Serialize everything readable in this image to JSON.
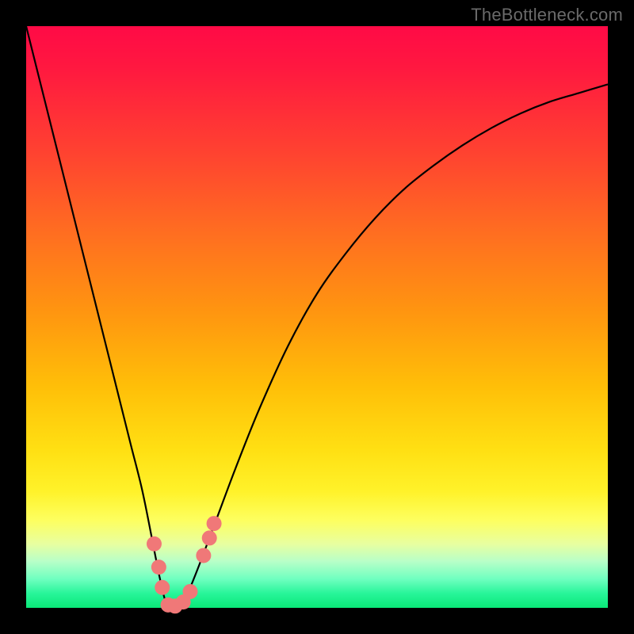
{
  "watermark": "TheBottleneck.com",
  "chart_data": {
    "type": "line",
    "title": "",
    "xlabel": "",
    "ylabel": "",
    "xlim": [
      0,
      100
    ],
    "ylim": [
      0,
      100
    ],
    "series": [
      {
        "name": "bottleneck-curve",
        "x": [
          0,
          2,
          4,
          6,
          8,
          10,
          12,
          14,
          16,
          18,
          20,
          22,
          23,
          24,
          25,
          26,
          27,
          28,
          30,
          33,
          36,
          40,
          45,
          50,
          55,
          60,
          65,
          70,
          75,
          80,
          85,
          90,
          95,
          100
        ],
        "y": [
          100,
          92,
          84,
          76,
          68,
          60,
          52,
          44,
          36,
          28,
          20,
          10,
          5,
          1,
          0,
          0,
          1,
          3,
          8,
          16,
          24,
          34,
          45,
          54,
          61,
          67,
          72,
          76,
          79.5,
          82.5,
          85,
          87,
          88.5,
          90
        ]
      }
    ],
    "markers": [
      {
        "name": "marker-left-upper",
        "x": 22.0,
        "y": 11.0
      },
      {
        "name": "marker-left-mid",
        "x": 22.8,
        "y": 7.0
      },
      {
        "name": "marker-left-low",
        "x": 23.4,
        "y": 3.5
      },
      {
        "name": "marker-bottom-1",
        "x": 24.4,
        "y": 0.5
      },
      {
        "name": "marker-bottom-2",
        "x": 25.6,
        "y": 0.3
      },
      {
        "name": "marker-bottom-3",
        "x": 27.0,
        "y": 1.0
      },
      {
        "name": "marker-bottom-4",
        "x": 28.2,
        "y": 2.8
      },
      {
        "name": "marker-right-low",
        "x": 30.5,
        "y": 9.0
      },
      {
        "name": "marker-right-mid",
        "x": 31.5,
        "y": 12.0
      },
      {
        "name": "marker-right-upper",
        "x": 32.3,
        "y": 14.5
      }
    ],
    "marker_color": "#f07878",
    "curve_color": "#000000"
  }
}
